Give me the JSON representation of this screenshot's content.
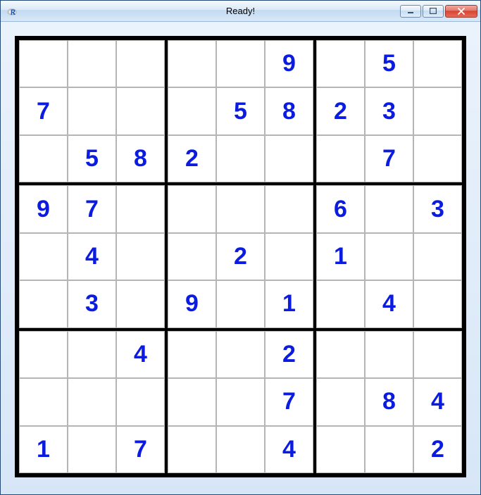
{
  "window": {
    "title": "Ready!",
    "icon_name": "r-logo"
  },
  "sudoku": {
    "given_color": "#0b1be0",
    "grid": [
      [
        "",
        "",
        "",
        "",
        "",
        "9",
        "",
        "5",
        ""
      ],
      [
        "7",
        "",
        "",
        "",
        "5",
        "8",
        "2",
        "3",
        ""
      ],
      [
        "",
        "5",
        "8",
        "2",
        "",
        "",
        "",
        "7",
        ""
      ],
      [
        "9",
        "7",
        "",
        "",
        "",
        "",
        "6",
        "",
        "3"
      ],
      [
        "",
        "4",
        "",
        "",
        "2",
        "",
        "1",
        "",
        ""
      ],
      [
        "",
        "3",
        "",
        "9",
        "",
        "1",
        "",
        "4",
        ""
      ],
      [
        "",
        "",
        "4",
        "",
        "",
        "2",
        "",
        "",
        ""
      ],
      [
        "",
        "",
        "",
        "",
        "",
        "7",
        "",
        "8",
        "4"
      ],
      [
        "1",
        "",
        "7",
        "",
        "",
        "4",
        "",
        "",
        "2"
      ]
    ]
  }
}
